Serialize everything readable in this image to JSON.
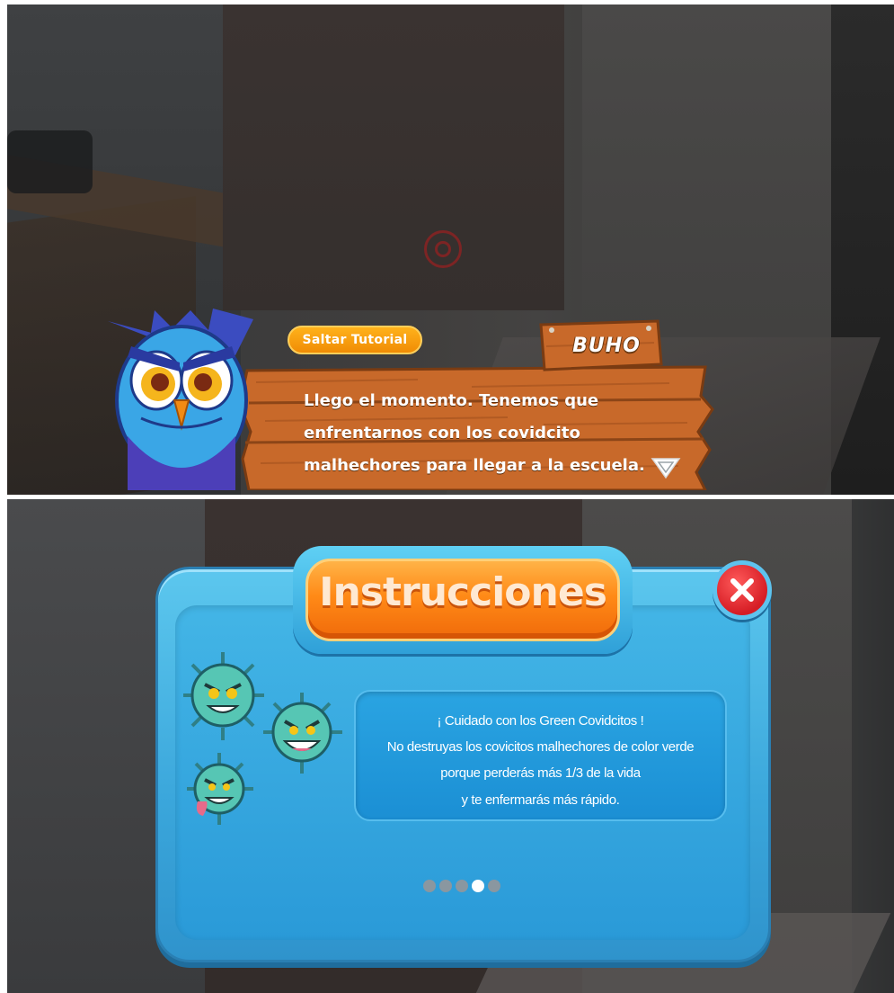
{
  "tutorial": {
    "skip_label": "Saltar Tutorial",
    "speaker_name": "BUHO",
    "dialog_lines": [
      "Llego el momento. Tenemos que",
      "enfrentarnos con los covidcito",
      "malhechores para llegar a la escuela."
    ]
  },
  "instructions": {
    "title": "Instrucciones",
    "lines": [
      "¡ Cuidado con los Green Covidcitos !",
      "No destruyas los covicitos malhechores de color verde",
      "porque perderás más 1/3 de la vida",
      "y te enfermarás más rápido."
    ],
    "page_indicator": {
      "total": 5,
      "current": 4
    }
  },
  "colors": {
    "accent_orange": "#ff8a17",
    "panel_blue": "#3aa6db",
    "close_red": "#d61d25",
    "wood": "#c8692a"
  },
  "icons": [
    "owl-character",
    "wood-sign",
    "next-arrow-icon",
    "close-icon",
    "virus-icon",
    "reticle-icon"
  ]
}
